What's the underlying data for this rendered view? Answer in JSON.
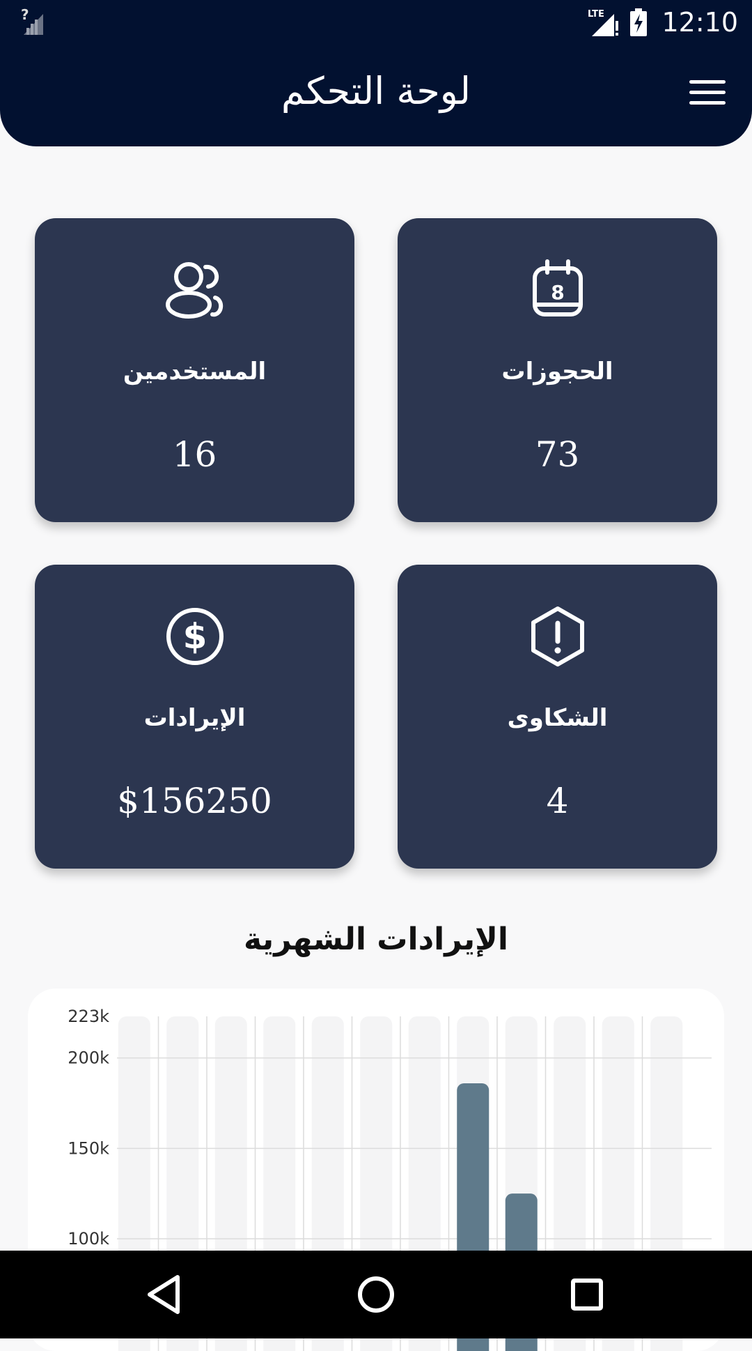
{
  "status_bar": {
    "time": "12:10",
    "network": "LTE",
    "icons": [
      "signal-unknown-icon",
      "lte-signal-icon",
      "battery-charging-icon"
    ]
  },
  "app_bar": {
    "title": "لوحة التحكم",
    "menu_icon": "hamburger-menu-icon"
  },
  "stats": [
    {
      "label": "الحجوزات",
      "value": "73",
      "icon": "calendar-icon"
    },
    {
      "label": "المستخدمين",
      "value": "16",
      "icon": "users-icon"
    },
    {
      "label": "الشكاوى",
      "value": "4",
      "icon": "alert-hexagon-icon"
    },
    {
      "label": "الإيرادات",
      "value": "$156250",
      "icon": "dollar-circle-icon"
    }
  ],
  "section_title": "الإيرادات الشهرية",
  "chart_data": {
    "type": "bar",
    "categories": [
      "",
      "",
      "",
      "",
      "",
      "",
      "",
      "",
      "",
      "",
      "",
      ""
    ],
    "values": [
      0,
      0,
      0,
      0,
      0,
      0,
      0,
      186000,
      125000,
      0,
      0,
      0
    ],
    "ytick_labels": [
      "223k",
      "200k",
      "150k",
      "100k"
    ],
    "yticks": [
      223000,
      200000,
      150000,
      100000
    ],
    "ylim": [
      0,
      223000
    ],
    "grid": true,
    "bar_color": "#5f7a8b",
    "track_color": "#f4f4f5"
  },
  "nav_bar": {
    "icons": [
      "back-triangle-icon",
      "home-circle-icon",
      "recents-square-icon"
    ]
  },
  "colors": {
    "primary": "#021130",
    "card": "#2c3650",
    "background": "#f8f8f9"
  }
}
